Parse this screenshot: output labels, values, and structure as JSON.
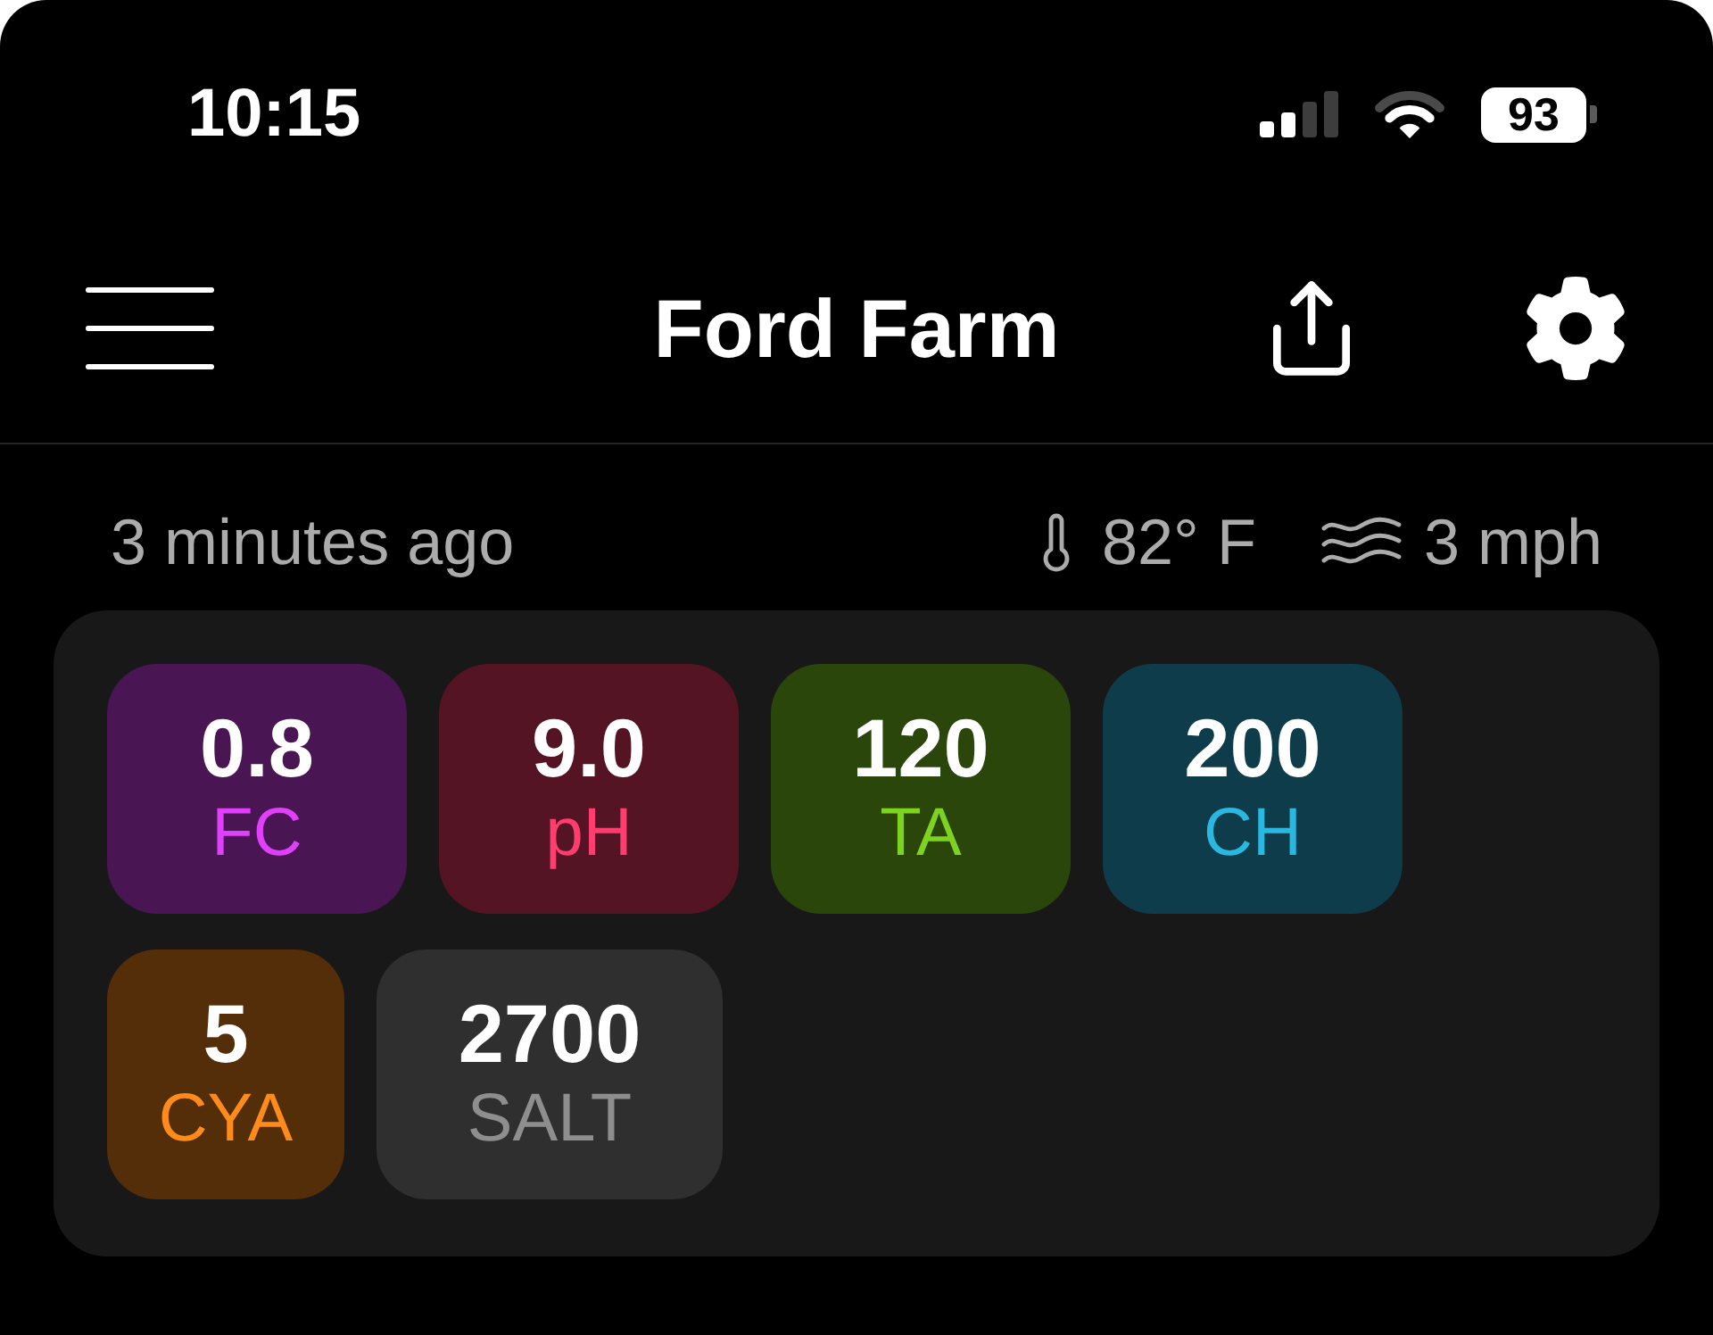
{
  "status_bar": {
    "time": "10:15",
    "battery": "93"
  },
  "header": {
    "title": "Ford Farm"
  },
  "conditions": {
    "updated": "3 minutes ago",
    "temperature": "82° F",
    "wind": "3 mph"
  },
  "readings": [
    {
      "value": "0.8",
      "label": "FC",
      "color": "#e040fb"
    },
    {
      "value": "9.0",
      "label": "pH",
      "color": "#ff3d6e"
    },
    {
      "value": "120",
      "label": "TA",
      "color": "#7ed321"
    },
    {
      "value": "200",
      "label": "CH",
      "color": "#2ab7e0"
    },
    {
      "value": "5",
      "label": "CYA",
      "color": "#ff8c1a"
    },
    {
      "value": "2700",
      "label": "SALT",
      "color": "#8e8e8e"
    }
  ]
}
